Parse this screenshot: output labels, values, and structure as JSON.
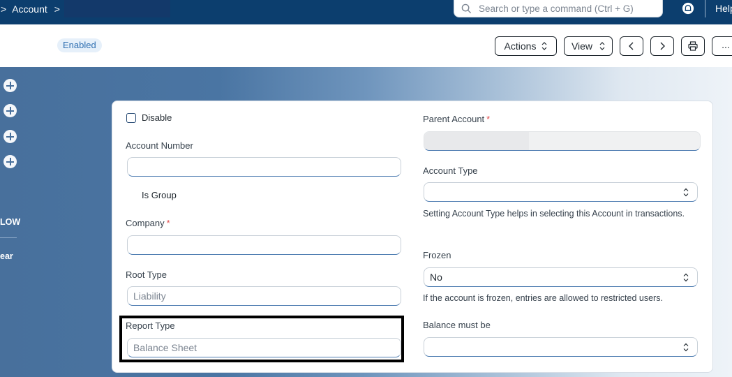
{
  "navbar": {
    "breadcrumb_arrow": ">",
    "breadcrumb_current": "Account",
    "breadcrumb_sep": ">",
    "search_placeholder": "Search or type a command (Ctrl + G)",
    "help_label": "Help"
  },
  "header": {
    "status_badge": "Enabled",
    "actions_label": "Actions",
    "view_label": "View",
    "prev_icon": "chevron-left-icon",
    "next_icon": "chevron-right-icon",
    "print_icon": "printer-icon",
    "more_label": "..."
  },
  "sidebar": {
    "add_icons": [
      "plus-circle-icon",
      "plus-circle-icon",
      "plus-circle-icon",
      "plus-circle-icon"
    ],
    "text_1": "LOW",
    "text_2": "ear"
  },
  "form": {
    "disable_label": "Disable",
    "disable_checked": false,
    "account_number_label": "Account Number",
    "account_number_value": "",
    "is_group_label": "Is Group",
    "company_label": "Company",
    "company_required": "*",
    "company_value": "",
    "root_type_label": "Root Type",
    "root_type_value": "Liability",
    "report_type_label": "Report Type",
    "report_type_value": "Balance Sheet",
    "parent_account_label": "Parent Account",
    "parent_account_required": "*",
    "parent_account_value": "",
    "account_type_label": "Account Type",
    "account_type_value": "",
    "account_type_help": "Setting Account Type helps in selecting this Account in transactions.",
    "frozen_label": "Frozen",
    "frozen_value": "No",
    "frozen_help": "If the account is frozen, entries are allowed to restricted users.",
    "balance_label": "Balance must be",
    "balance_value": ""
  },
  "colors": {
    "navbar": "#0c3e6e",
    "accent": "#2f6fb1",
    "required": "#e24c4c"
  }
}
